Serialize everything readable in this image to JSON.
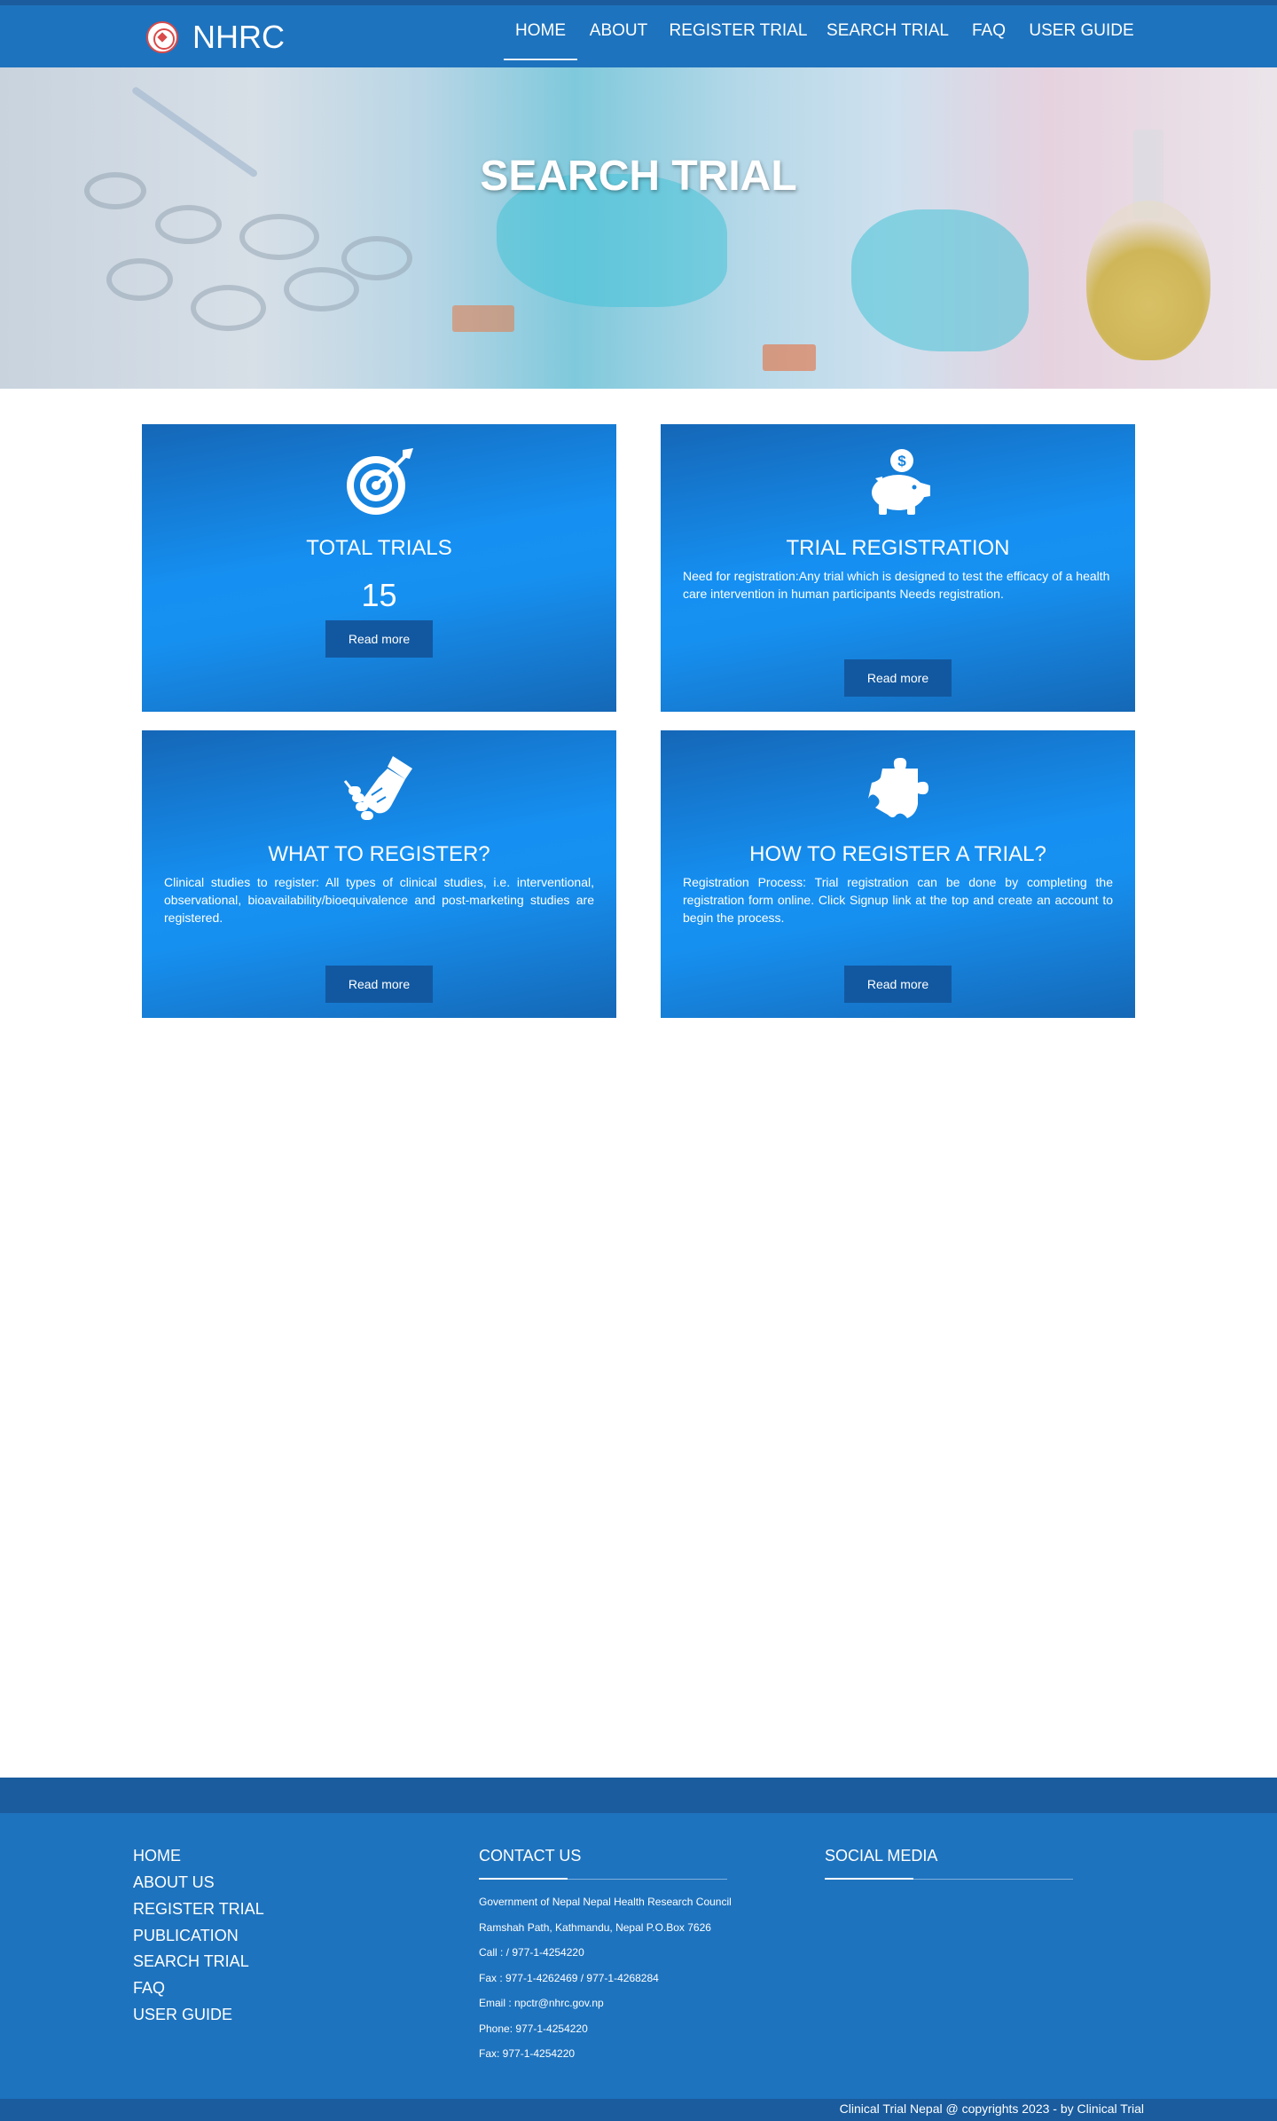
{
  "header": {
    "brand": "NHRC",
    "nav": [
      {
        "label": "HOME",
        "active": true
      },
      {
        "label": "ABOUT",
        "active": false
      },
      {
        "label": "REGISTER TRIAL",
        "active": false
      },
      {
        "label": "SEARCH TRIAL",
        "active": false
      },
      {
        "label": "FAQ",
        "active": false
      },
      {
        "label": "USER GUIDE",
        "active": false
      }
    ]
  },
  "hero": {
    "title": "SEARCH TRIAL"
  },
  "cards": [
    {
      "icon": "target-icon",
      "title": "TOTAL TRIALS",
      "number": "15",
      "button": "Read more"
    },
    {
      "icon": "piggy-bank-icon",
      "title": "TRIAL REGISTRATION",
      "text": "Need for registration:Any trial which is designed to test the efficacy of a health care intervention in human participants Needs registration.",
      "button": "Read more"
    },
    {
      "icon": "handshake-icon",
      "title": "WHAT TO REGISTER?",
      "text": "Clinical studies to register: All types of clinical studies, i.e. interventional, observational, bioavailability/bioequivalence and post-marketing studies are registered.",
      "button": "Read more"
    },
    {
      "icon": "puzzle-icon",
      "title": "HOW TO REGISTER A TRIAL?",
      "text": "Registration Process: Trial registration can be done by completing the registration form online. Click Signup link at the top and create an account to begin the process.",
      "button": "Read more"
    }
  ],
  "footer": {
    "links": [
      "HOME",
      "ABOUT US",
      "REGISTER TRIAL",
      "PUBLICATION",
      "SEARCH TRIAL",
      "FAQ",
      "USER GUIDE"
    ],
    "contact_heading": "CONTACT US",
    "contact": [
      "Government of Nepal Nepal Health Research Council",
      "Ramshah Path, Kathmandu, Nepal P.O.Box 7626",
      "Call : / 977-1-4254220",
      "Fax : 977-1-4262469 / 977-1-4268284",
      "Email : npctr@nhrc.gov.np",
      "Phone: 977-1-4254220",
      "Fax: 977-1-4254220"
    ],
    "social_heading": "SOCIAL MEDIA",
    "copyright": "Clinical Trial Nepal @ copyrights 2023 - by Clinical Trial"
  },
  "colors": {
    "nav_bg": "#1e73be",
    "nav_topline": "#1a5c9e",
    "card_gradient_dark": "#1567b7",
    "card_gradient_light": "#1590f2",
    "button_bg": "#1258a0",
    "footer_bg": "#1e73be"
  }
}
